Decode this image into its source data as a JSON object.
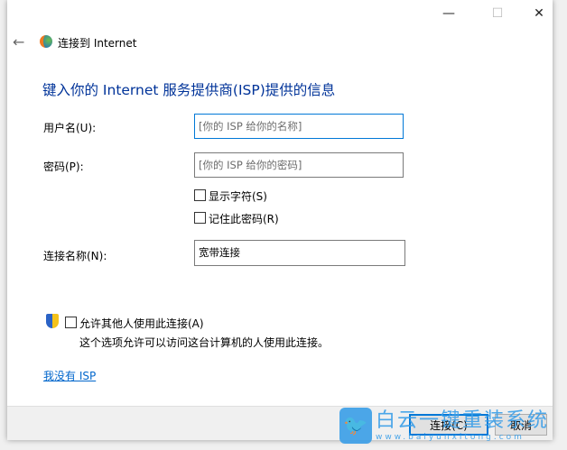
{
  "window": {
    "title": "连接到 Internet",
    "controls": {
      "minimize": "—",
      "maximize": "☐",
      "close": "✕"
    }
  },
  "heading": "键入你的 Internet 服务提供商(ISP)提供的信息",
  "form": {
    "username_label": "用户名(U):",
    "username_placeholder": "[你的 ISP 给你的名称]",
    "password_label": "密码(P):",
    "password_placeholder": "[你的 ISP 给你的密码]",
    "show_chars_label": "显示字符(S)",
    "show_chars_checked": false,
    "remember_label": "记住此密码(R)",
    "remember_checked": false,
    "conn_name_label": "连接名称(N):",
    "conn_name_value": "宽带连接"
  },
  "allow_others": {
    "label": "允许其他人使用此连接(A)",
    "checked": false,
    "description": "这个选项允许可以访问这台计算机的人使用此连接。"
  },
  "no_isp_link": "我没有 ISP",
  "buttons": {
    "connect": "连接(C)",
    "cancel": "取消"
  },
  "watermark": {
    "title": "白云一键重装系统",
    "url": "www.baiyunxitong.com"
  },
  "colors": {
    "heading": "#003399",
    "link": "#0066cc",
    "focus": "#0078d7"
  }
}
